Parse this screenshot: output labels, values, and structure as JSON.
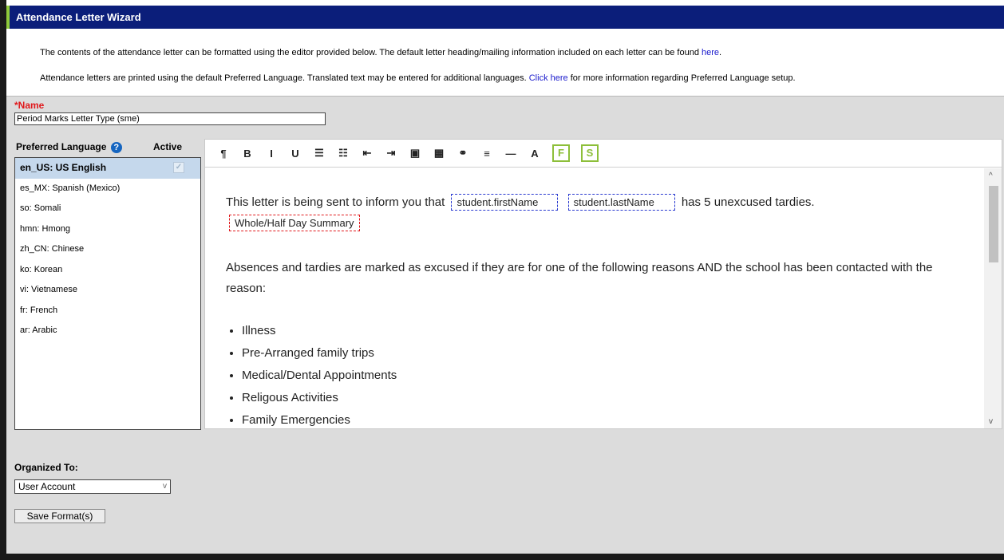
{
  "window": {
    "title": "Attendance Letter Wizard"
  },
  "info": {
    "line1_text": "The contents of the attendance letter can be formatted using the editor provided below. The default letter heading/mailing information included on each letter can be found ",
    "line1_link": "here",
    "line1_end": ".",
    "line2_text": "Attendance letters are printed using the default Preferred Language. Translated text may be entered for additional languages. ",
    "line2_link": "Click here",
    "line2_end": " for more information regarding Preferred Language setup."
  },
  "name": {
    "label": "*Name",
    "value": "Period Marks Letter Type (sme)"
  },
  "languages": {
    "header": "Preferred Language",
    "help_icon": "?",
    "active_label": "Active",
    "items": [
      {
        "label": "en_US: US English",
        "selected": true
      },
      {
        "label": "es_MX: Spanish (Mexico)"
      },
      {
        "label": "so: Somali"
      },
      {
        "label": "hmn: Hmong"
      },
      {
        "label": "zh_CN: Chinese"
      },
      {
        "label": "ko: Korean"
      },
      {
        "label": "vi: Vietnamese"
      },
      {
        "label": "fr: French"
      },
      {
        "label": "ar: Arabic"
      }
    ]
  },
  "toolbar": {
    "buttons": [
      {
        "name": "paragraph-icon",
        "glyph": "¶"
      },
      {
        "name": "bold-icon",
        "glyph": "B"
      },
      {
        "name": "italic-icon",
        "glyph": "I"
      },
      {
        "name": "underline-icon",
        "glyph": "U"
      },
      {
        "name": "bulleted-list-icon",
        "glyph": "☰"
      },
      {
        "name": "numbered-list-icon",
        "glyph": "☷"
      },
      {
        "name": "outdent-icon",
        "glyph": "⇤"
      },
      {
        "name": "indent-icon",
        "glyph": "⇥"
      },
      {
        "name": "image-icon",
        "glyph": "▣"
      },
      {
        "name": "table-icon",
        "glyph": "▦"
      },
      {
        "name": "link-icon",
        "glyph": "⚭"
      },
      {
        "name": "align-icon",
        "glyph": "≡"
      },
      {
        "name": "horizontal-rule-icon",
        "glyph": "—"
      },
      {
        "name": "font-color-icon",
        "glyph": "A"
      }
    ],
    "field_button": "F",
    "sub_report_button": "S"
  },
  "letter": {
    "intro": "This letter is being sent to inform you that",
    "field_first": "student.firstName",
    "field_last": "student.lastName",
    "intro_end": "has 5 unexcused tardies.",
    "summary_field": "Whole/Half Day Summary",
    "para2": "Absences and tardies are marked as excused if they are for one of the following reasons AND the school has been contacted with the reason:",
    "reasons": [
      "Illness",
      "Pre-Arranged family trips",
      "Medical/Dental Appointments",
      "Religous Activities",
      "Family Emergencies"
    ]
  },
  "organized": {
    "label": "Organized To:",
    "selected": "User Account"
  },
  "save_label": "Save Format(s)"
}
